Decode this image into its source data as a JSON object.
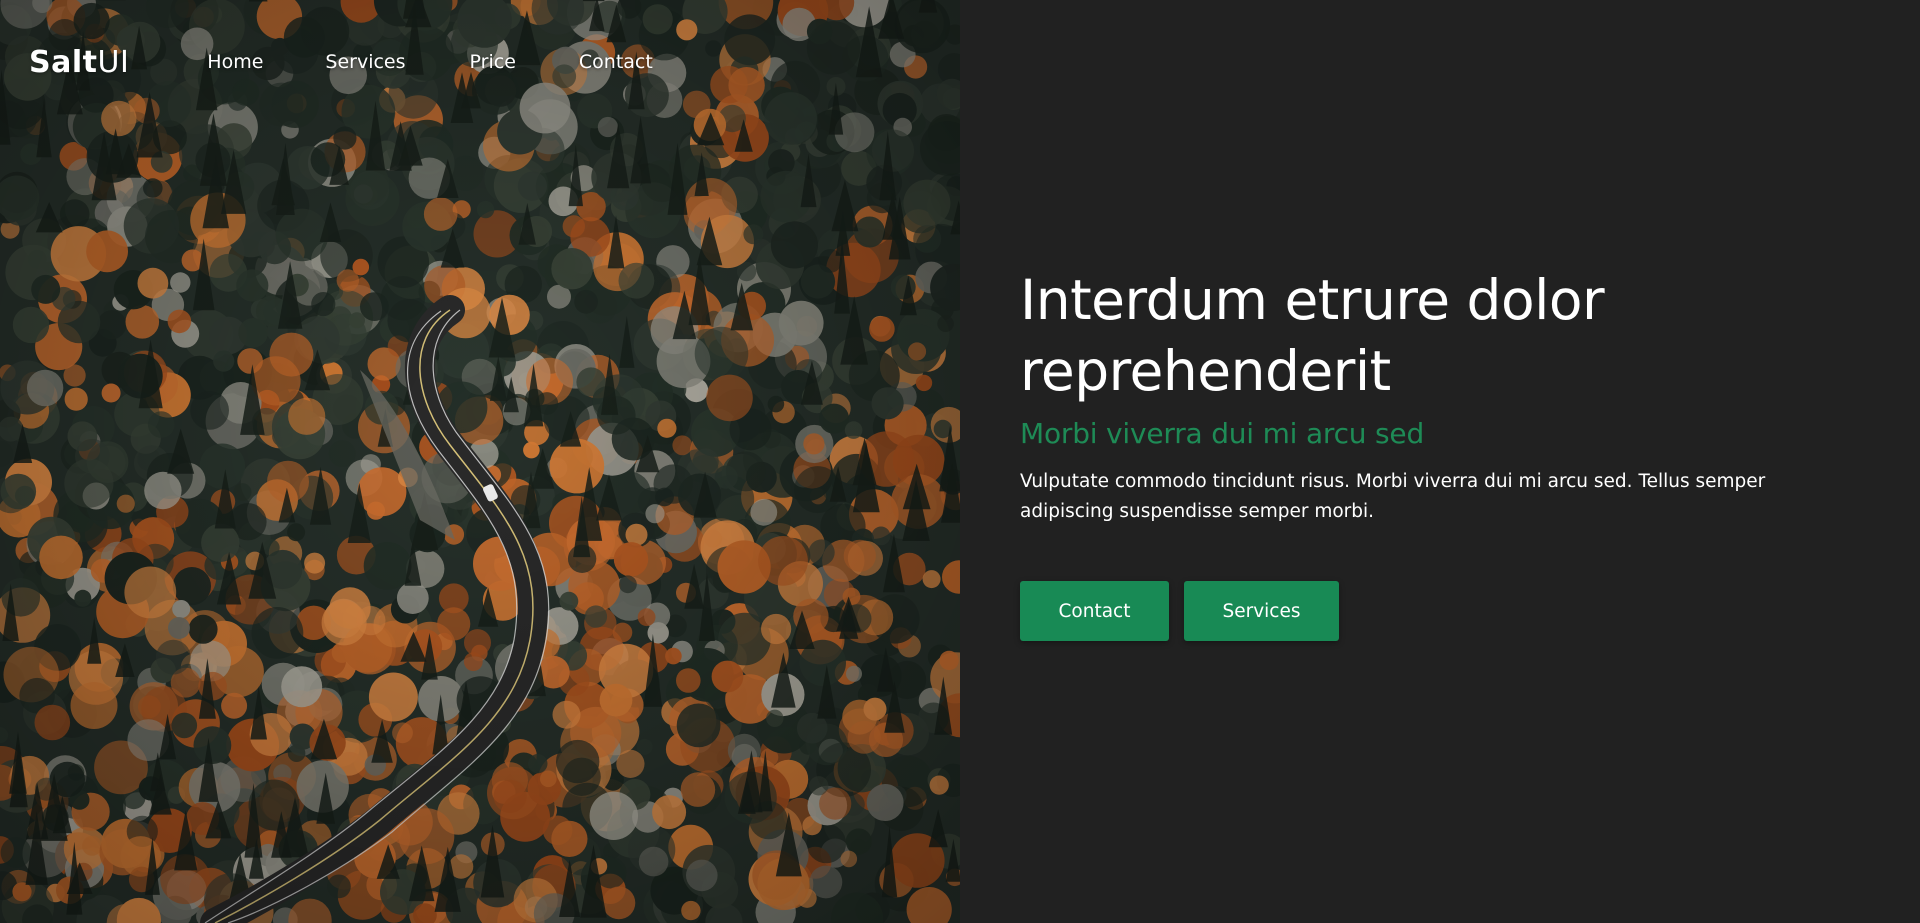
{
  "nav": {
    "logo_bold": "Salt",
    "logo_light": "UI",
    "links": [
      "Home",
      "Services",
      "Price",
      "Contact"
    ]
  },
  "hero": {
    "image_label": "aerial-forest-road-photo",
    "title_line1": "Interdum etrure dolor",
    "title_line2": "reprehenderit",
    "subtitle": "Morbi viverra dui mi arcu sed",
    "body_line1": "Vulputate commodo tincidunt risus. Morbi viverra dui mi arcu sed. Tellus semper",
    "body_line2": "adipiscing suspendisse semper morbi.",
    "buttons": {
      "primary": "Contact",
      "secondary": "Services"
    }
  },
  "colors": {
    "background": "#212121",
    "accent": "#1e8b56",
    "button": "#188a55",
    "text": "#ffffff"
  }
}
